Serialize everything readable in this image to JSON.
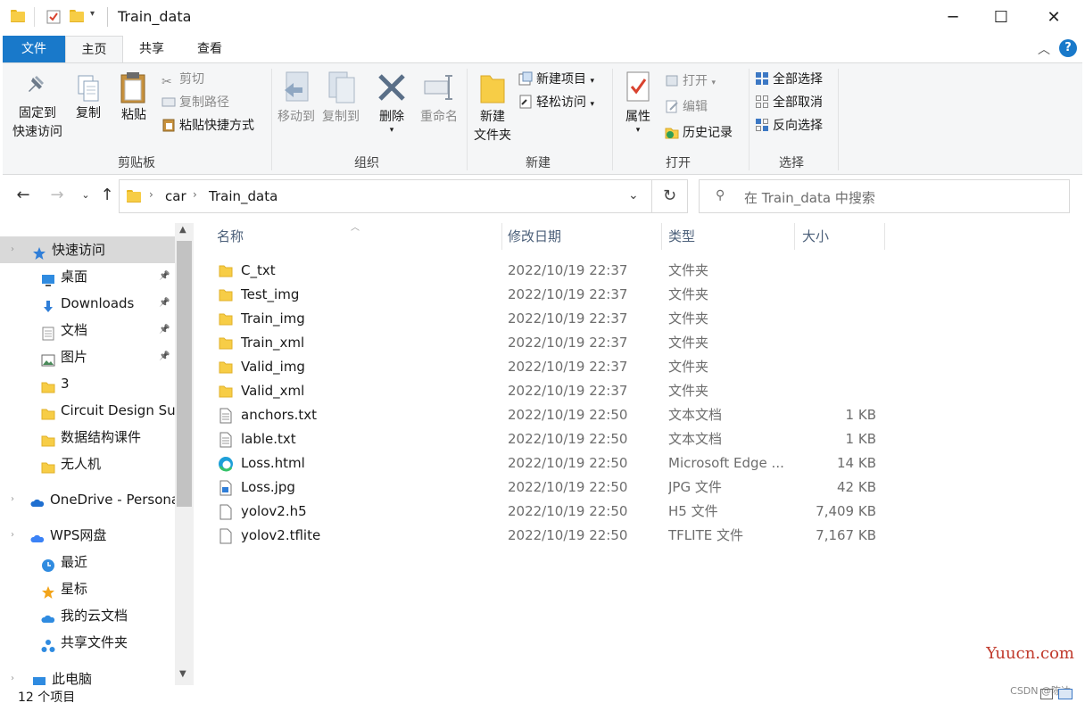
{
  "window": {
    "title": "Train_data",
    "minimize": "─",
    "maximize": "☐",
    "close": "✕"
  },
  "ribbon_tabs": [
    "文件",
    "主页",
    "共享",
    "查看"
  ],
  "ribbon": {
    "clipboard": {
      "pin_label_1": "固定到",
      "pin_label_2": "快速访问",
      "copy": "复制",
      "paste": "粘贴",
      "cut": "剪切",
      "copy_path": "复制路径",
      "paste_shortcut": "粘贴快捷方式",
      "group": "剪贴板"
    },
    "organize": {
      "move_to": "移动到",
      "copy_to": "复制到",
      "delete": "删除",
      "rename": "重命名",
      "group": "组织"
    },
    "new": {
      "new_folder_1": "新建",
      "new_folder_2": "文件夹",
      "new_item": "新建项目",
      "easy_access": "轻松访问",
      "group": "新建"
    },
    "open": {
      "properties": "属性",
      "open": "打开",
      "edit": "编辑",
      "history": "历史记录",
      "group": "打开"
    },
    "select": {
      "select_all": "全部选择",
      "select_none": "全部取消",
      "invert": "反向选择",
      "group": "选择"
    }
  },
  "address": {
    "crumbs": [
      "car",
      "Train_data"
    ],
    "search_placeholder": "在 Train_data 中搜索"
  },
  "navpane": [
    {
      "label": "快速访问",
      "icon": "star-icon",
      "selected": true,
      "pinned": false
    },
    {
      "label": "桌面",
      "icon": "desktop-icon",
      "pinned": true
    },
    {
      "label": "Downloads",
      "icon": "download-icon",
      "pinned": true
    },
    {
      "label": "文档",
      "icon": "document-icon",
      "pinned": true
    },
    {
      "label": "图片",
      "icon": "pictures-icon",
      "pinned": true
    },
    {
      "label": "3",
      "icon": "folder-icon",
      "pinned": false
    },
    {
      "label": "Circuit Design Sui",
      "icon": "folder-icon",
      "pinned": false
    },
    {
      "label": "数据结构课件",
      "icon": "folder-icon",
      "pinned": false
    },
    {
      "label": "无人机",
      "icon": "folder-icon",
      "pinned": false
    },
    {
      "label": "OneDrive - Persona",
      "icon": "onedrive-icon",
      "pinned": false
    },
    {
      "label": "WPS网盘",
      "icon": "wps-cloud-icon",
      "pinned": false
    },
    {
      "label": "最近",
      "icon": "clock-icon",
      "pinned": false
    },
    {
      "label": "星标",
      "icon": "star-gold-icon",
      "pinned": false
    },
    {
      "label": "我的云文档",
      "icon": "cloud-doc-icon",
      "pinned": false
    },
    {
      "label": "共享文件夹",
      "icon": "shared-folder-icon",
      "pinned": false
    },
    {
      "label": "此电脑",
      "icon": "computer-icon",
      "pinned": false
    }
  ],
  "columns": {
    "name": "名称",
    "date": "修改日期",
    "type": "类型",
    "size": "大小"
  },
  "files": [
    {
      "name": "C_txt",
      "date": "2022/10/19 22:37",
      "type": "文件夹",
      "size": "",
      "icon": "folder-icon"
    },
    {
      "name": "Test_img",
      "date": "2022/10/19 22:37",
      "type": "文件夹",
      "size": "",
      "icon": "folder-icon"
    },
    {
      "name": "Train_img",
      "date": "2022/10/19 22:37",
      "type": "文件夹",
      "size": "",
      "icon": "folder-icon"
    },
    {
      "name": "Train_xml",
      "date": "2022/10/19 22:37",
      "type": "文件夹",
      "size": "",
      "icon": "folder-icon"
    },
    {
      "name": "Valid_img",
      "date": "2022/10/19 22:37",
      "type": "文件夹",
      "size": "",
      "icon": "folder-icon"
    },
    {
      "name": "Valid_xml",
      "date": "2022/10/19 22:37",
      "type": "文件夹",
      "size": "",
      "icon": "folder-icon"
    },
    {
      "name": "anchors.txt",
      "date": "2022/10/19 22:50",
      "type": "文本文档",
      "size": "1 KB",
      "icon": "text-file-icon"
    },
    {
      "name": "lable.txt",
      "date": "2022/10/19 22:50",
      "type": "文本文档",
      "size": "1 KB",
      "icon": "text-file-icon"
    },
    {
      "name": "Loss.html",
      "date": "2022/10/19 22:50",
      "type": "Microsoft Edge ...",
      "size": "14 KB",
      "icon": "edge-icon"
    },
    {
      "name": "Loss.jpg",
      "date": "2022/10/19 22:50",
      "type": "JPG 文件",
      "size": "42 KB",
      "icon": "image-file-icon"
    },
    {
      "name": "yolov2.h5",
      "date": "2022/10/19 22:50",
      "type": "H5 文件",
      "size": "7,409 KB",
      "icon": "blank-file-icon"
    },
    {
      "name": "yolov2.tflite",
      "date": "2022/10/19 22:50",
      "type": "TFLITE 文件",
      "size": "7,167 KB",
      "icon": "blank-file-icon"
    }
  ],
  "status": {
    "item_count": "12 个项目"
  },
  "watermark": "Yuucn.com",
  "csdn": "CSDN @陈达"
}
